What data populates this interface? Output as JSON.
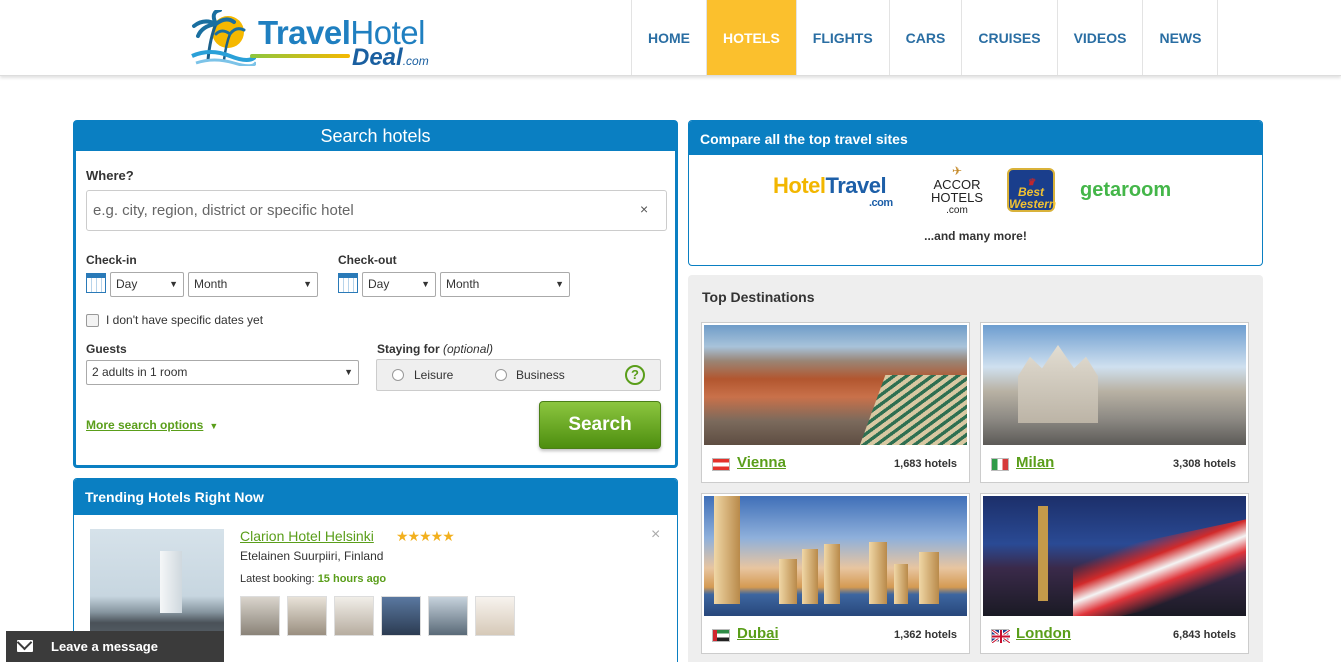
{
  "header": {
    "logo": {
      "part1": "Travel",
      "part2": "Hotel",
      "part3": "Deal",
      "suffix": ".com"
    },
    "nav": [
      {
        "label": "HOME",
        "active": false
      },
      {
        "label": "HOTELS",
        "active": true
      },
      {
        "label": "FLIGHTS",
        "active": false
      },
      {
        "label": "CARS",
        "active": false
      },
      {
        "label": "CRUISES",
        "active": false
      },
      {
        "label": "VIDEOS",
        "active": false
      },
      {
        "label": "NEWS",
        "active": false
      }
    ],
    "accent_color": "#fbc02d"
  },
  "search": {
    "title": "Search hotels",
    "where_label": "Where?",
    "where_placeholder": "e.g. city, region, district or specific hotel",
    "clear": "×",
    "checkin_label": "Check-in",
    "checkout_label": "Check-out",
    "day_value": "Day",
    "month_value": "Month",
    "no_dates_label": "I don't have specific dates yet",
    "guests_label": "Guests",
    "guests_value": "2 adults in 1 room",
    "staying_label": "Staying for",
    "staying_optional": "(optional)",
    "leisure": "Leisure",
    "business": "Business",
    "help": "?",
    "more_options": "More search options",
    "search_button": "Search"
  },
  "trending": {
    "title": "Trending Hotels Right Now",
    "hotel_name": "Clarion Hotel Helsinki",
    "stars": "★★★★★",
    "star_rating": 4.5,
    "location": "Etelainen Suurpiiri, Finland",
    "latest_label": "Latest booking:",
    "latest_value": "15 hours ago",
    "close": "×"
  },
  "message_bar": {
    "label": "Leave a message"
  },
  "compare": {
    "title": "Compare all the top travel sites",
    "brands": {
      "hoteltravel_a": "Hotel",
      "hoteltravel_b": "Travel",
      "hoteltravel_c": ".com",
      "accor_1": "ACCOR",
      "accor_2": "HOTELS",
      "accor_3": ".com",
      "bw_1": "Best",
      "bw_2": "Western",
      "getaroom": "getaroom"
    },
    "more": "...and many more!"
  },
  "destinations": {
    "title": "Top Destinations",
    "items": [
      {
        "city": "Vienna",
        "count": "1,683 hotels"
      },
      {
        "city": "Milan",
        "count": "3,308 hotels"
      },
      {
        "city": "Dubai",
        "count": "1,362 hotels"
      },
      {
        "city": "London",
        "count": "6,843 hotels"
      }
    ]
  }
}
